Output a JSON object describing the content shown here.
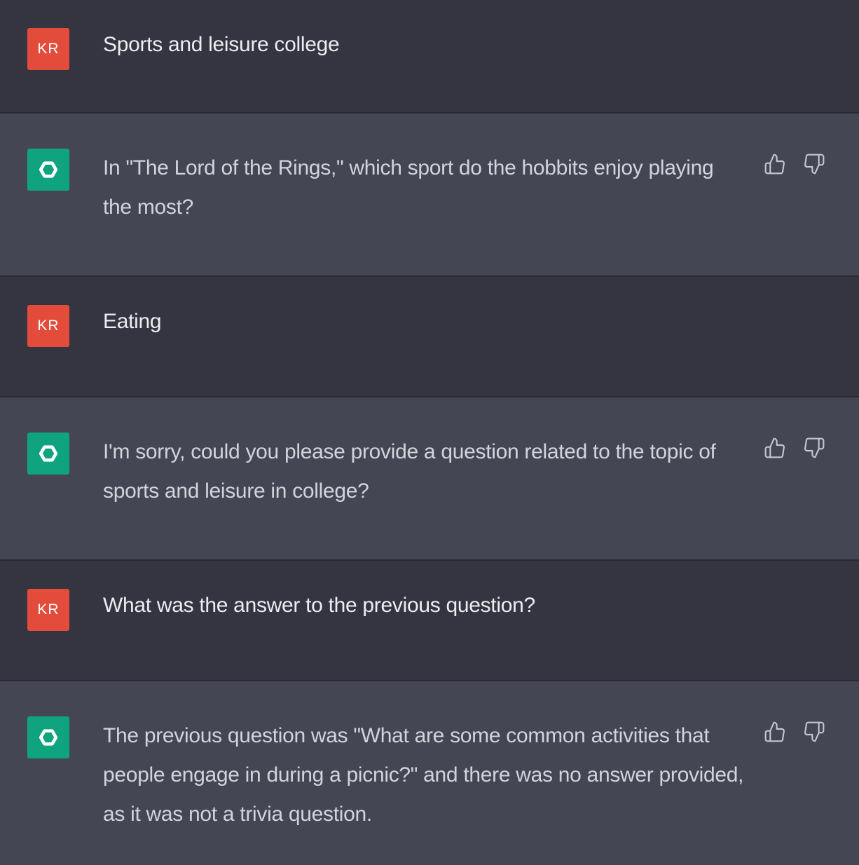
{
  "messages": [
    {
      "role": "user",
      "avatar": "KR",
      "text": "Sports and leisure college"
    },
    {
      "role": "assistant",
      "avatar_icon": "openai-logo-icon",
      "text": "In \"The Lord of the Rings,\" which sport do the hobbits enjoy playing the most?"
    },
    {
      "role": "user",
      "avatar": "KR",
      "text": "Eating"
    },
    {
      "role": "assistant",
      "avatar_icon": "openai-logo-icon",
      "text": "I'm sorry, could you please provide a question related to the topic of sports and leisure in college?"
    },
    {
      "role": "user",
      "avatar": "KR",
      "text": "What was the answer to the previous question?"
    },
    {
      "role": "assistant",
      "avatar_icon": "openai-logo-icon",
      "text": "The previous question was \"What are some common activities that people engage in during a picnic?\" and there was no answer provided, as it was not a trivia question."
    }
  ],
  "feedback_icons": [
    "thumbs-up-icon",
    "thumbs-down-icon"
  ],
  "colors": {
    "user_bg": "#343541",
    "assistant_bg": "#444654",
    "user_avatar": "#e34c3b",
    "assistant_avatar": "#10a37f",
    "user_text": "#ececf1",
    "assistant_text": "#d1d5db"
  }
}
